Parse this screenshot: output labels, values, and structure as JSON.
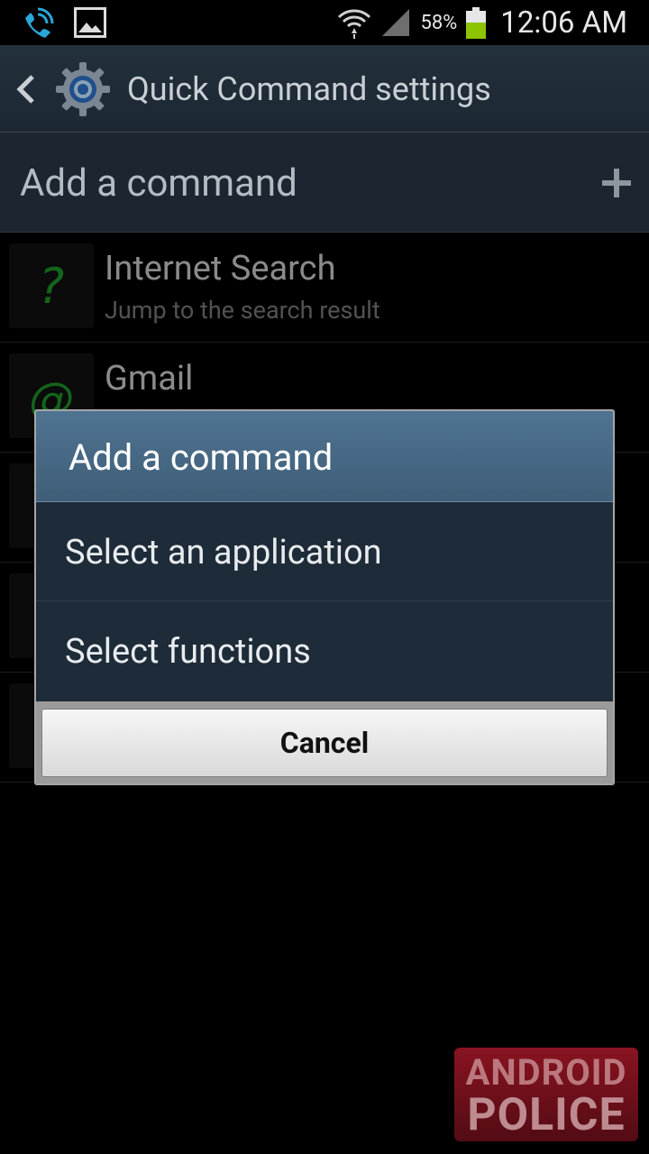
{
  "status_bar": {
    "battery_percent": "58%",
    "time": "12:06 AM",
    "icons": [
      "wifi-calling-icon",
      "gallery-icon",
      "wifi-icon",
      "signal-icon",
      "battery-icon"
    ]
  },
  "action_bar": {
    "title": "Quick Command settings",
    "icons": [
      "back-chevron-icon",
      "gear-icon"
    ]
  },
  "add_command_bar": {
    "label": "Add a command",
    "icon": "plus-icon"
  },
  "commands": [
    {
      "title": "Internet Search",
      "subtitle": "Jump to the search result",
      "icon": "question-mark-icon"
    },
    {
      "title": "Gmail",
      "subtitle": "",
      "icon": "at-sign-icon"
    },
    {
      "title": "",
      "subtitle": "",
      "icon": ""
    },
    {
      "title": "",
      "subtitle": "",
      "icon": ""
    },
    {
      "title": "",
      "subtitle": "",
      "icon": ""
    }
  ],
  "dialog": {
    "title": "Add a command",
    "options": [
      "Select an application",
      "Select functions"
    ],
    "cancel_label": "Cancel"
  },
  "watermark": {
    "line1": "ANDROID",
    "line2": "POLICE"
  },
  "colors": {
    "accent_green": "#22a32d",
    "dialog_header": "#4f7391",
    "battery_fill": "#8cc400"
  }
}
